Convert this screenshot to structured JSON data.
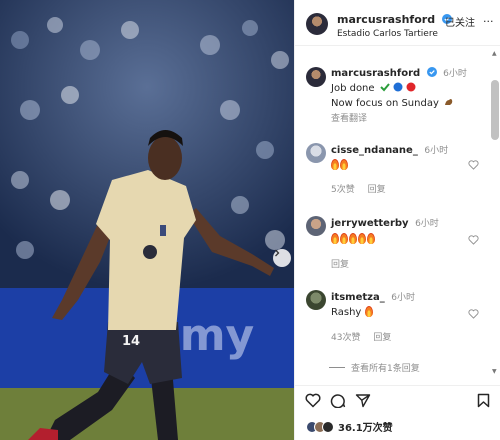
{
  "post": {
    "username": "marcusrashford",
    "location": "Estadio Carlos Tartiere",
    "follow_label": "已关注",
    "more_label": "...",
    "caption_time": "6小时",
    "caption_line1": "Job done",
    "caption_line2": "Now focus on Sunday",
    "translate_label": "查看翻译",
    "player_number": "14",
    "ad_text": "amy",
    "next_icon": "chevron-right-icon"
  },
  "comments": [
    {
      "username": "cisse_ndanane_",
      "time": "6小时",
      "flames": 2,
      "likes": "5次赞",
      "reply": "回复"
    },
    {
      "username": "jerrywetterby",
      "time": "6小时",
      "flames": 5,
      "likes": "",
      "reply": "回复"
    },
    {
      "username": "itsmetza_",
      "time": "6小时",
      "text": "Rashy",
      "flames": 1,
      "likes": "43次赞",
      "reply": "回复"
    }
  ],
  "view_replies": "查看所有1条回复",
  "likes_count": "36.1万次赞",
  "colors": {
    "verified": "#3897f0",
    "check": "#2a9d3a",
    "blue_dot": "#1f6fd6",
    "red_dot": "#e0262a",
    "muscle": "#8a5a2b"
  }
}
